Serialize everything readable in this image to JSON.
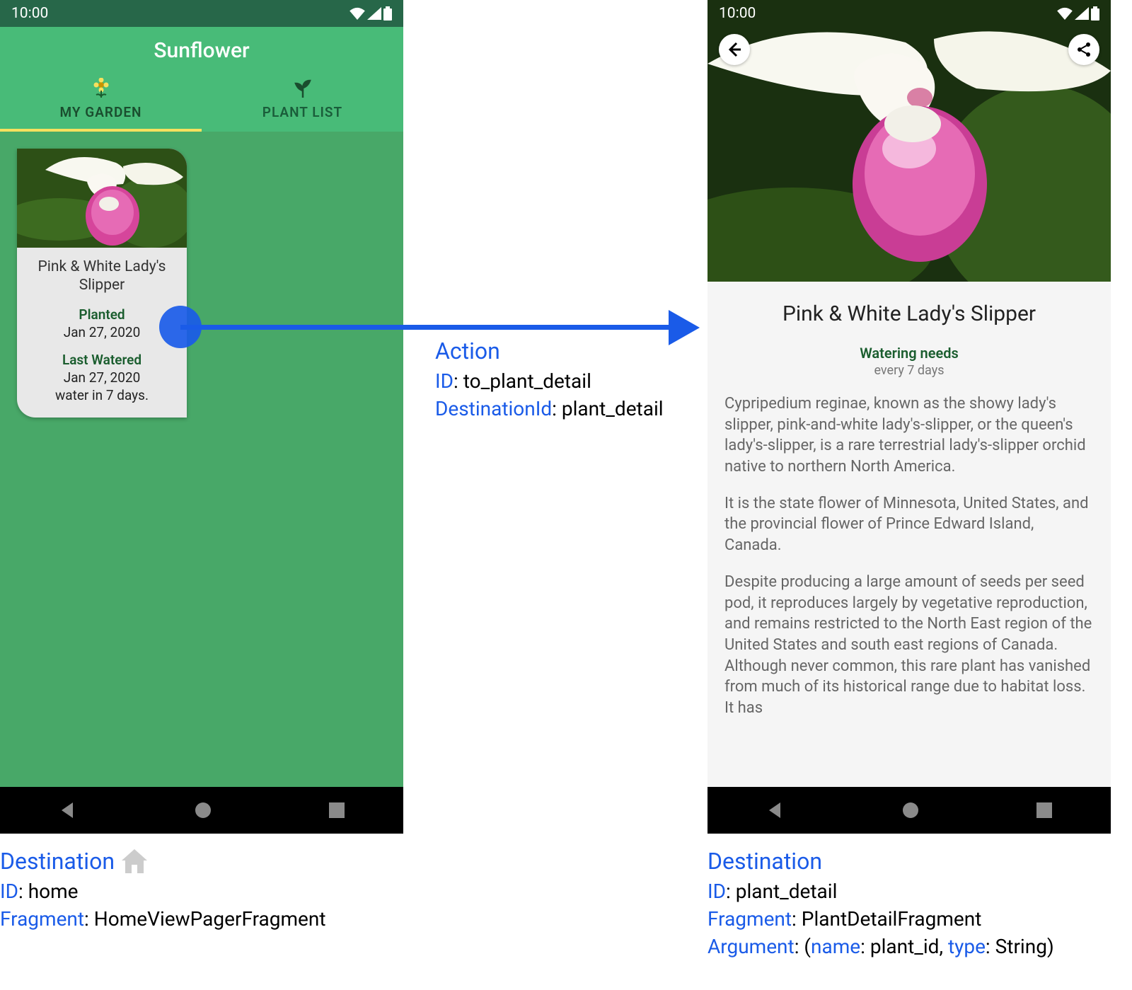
{
  "status": {
    "time": "10:00"
  },
  "left_screen": {
    "app_title": "Sunflower",
    "tabs": [
      {
        "label": "MY GARDEN",
        "icon": "flower"
      },
      {
        "label": "PLANT LIST",
        "icon": "sprout"
      }
    ],
    "card": {
      "title": "Pink & White Lady's Slipper",
      "planted_label": "Planted",
      "planted_date": "Jan 27, 2020",
      "watered_label": "Last Watered",
      "watered_date": "Jan 27, 2020",
      "water_in": "water in 7 days."
    }
  },
  "right_screen": {
    "title": "Pink & White Lady's Slipper",
    "watering_label": "Watering needs",
    "watering_value": "every 7 days",
    "description": {
      "p1": "Cypripedium reginae, known as the showy lady's slipper, pink-and-white lady's-slipper, or the queen's lady's-slipper, is a rare terrestrial lady's-slipper orchid native to northern North America.",
      "p2": "It is the state flower of Minnesota, United States, and the provincial flower of Prince Edward Island, Canada.",
      "p3": "Despite producing a large amount of seeds per seed pod, it reproduces largely by vegetative reproduction, and remains restricted to the North East region of the United States and south east regions of Canada. Although never common, this rare plant has vanished from much of its historical range due to habitat loss. It has"
    }
  },
  "action": {
    "heading": "Action",
    "id_label": "ID",
    "id_value": "to_plant_detail",
    "dest_label": "DestinationId",
    "dest_value": "plant_detail"
  },
  "dest_left": {
    "heading": "Destination",
    "id_label": "ID",
    "id_value": "home",
    "frag_label": "Fragment",
    "frag_value": "HomeViewPagerFragment"
  },
  "dest_right": {
    "heading": "Destination",
    "id_label": "ID",
    "id_value": "plant_detail",
    "frag_label": "Fragment",
    "frag_value": "PlantDetailFragment",
    "arg_label": "Argument",
    "arg_name_label": "name",
    "arg_name_value": "plant_id",
    "arg_type_label": "type",
    "arg_type_value": "String"
  }
}
